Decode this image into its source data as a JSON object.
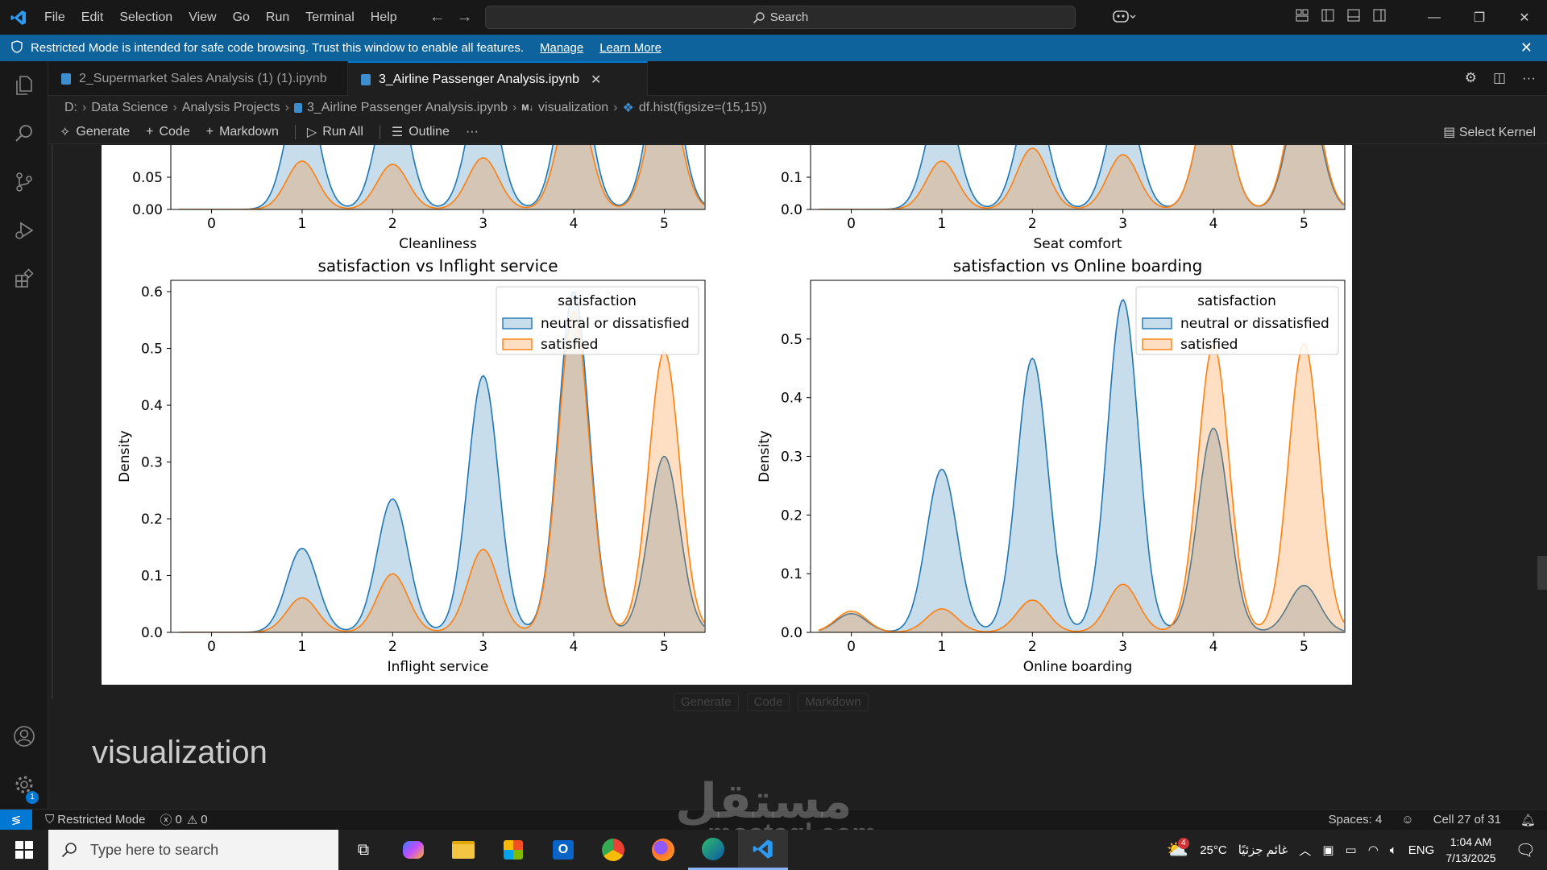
{
  "menu": [
    "File",
    "Edit",
    "Selection",
    "View",
    "Go",
    "Run",
    "Terminal",
    "Help"
  ],
  "search": {
    "label": "Search"
  },
  "banner": {
    "text": "Restricted Mode is intended for safe code browsing. Trust this window to enable all features.",
    "manage": "Manage",
    "learn_more": "Learn More"
  },
  "tabs": [
    {
      "label": "2_Supermarket Sales Analysis (1) (1).ipynb",
      "active": false
    },
    {
      "label": "3_Airline Passenger Analysis.ipynb",
      "active": true
    }
  ],
  "breadcrumb": [
    "D:",
    "Data Science",
    "Analysis Projects",
    "3_Airline Passenger Analysis.ipynb",
    "visualization",
    "df.hist(figsize=(15,15))"
  ],
  "toolbar": {
    "generate": "Generate",
    "code": "Code",
    "markdown": "Markdown",
    "run_all": "Run All",
    "outline": "Outline",
    "more": "···",
    "kernel": "Select Kernel"
  },
  "cell_add": {
    "generate": "Generate",
    "code": "Code",
    "markdown": "Markdown"
  },
  "markdown_heading": "visualization",
  "status": {
    "restricted": "Restricted Mode",
    "errors": "0",
    "warnings": "0",
    "spaces": "Spaces: 4",
    "cell": "Cell 27 of 31"
  },
  "activity_badge": "1",
  "taskbar": {
    "search_placeholder": "Type here to search",
    "weather_temp": "25°C",
    "weather_text": "غائم جزئيًا",
    "weather_badge": "4",
    "lang": "ENG",
    "time": "1:04 AM",
    "date": "7/13/2025"
  },
  "watermark": {
    "line1": "مستقل",
    "line2": "mostaql.com"
  },
  "chart_data": [
    {
      "type": "area",
      "title": "",
      "xlabel": "Cleanliness",
      "ylabel": "",
      "y_ticks": [
        "0.00",
        "0.05"
      ],
      "x_ticks": [
        "0",
        "1",
        "2",
        "3",
        "4",
        "5"
      ],
      "partial": true
    },
    {
      "type": "area",
      "title": "",
      "xlabel": "Seat comfort",
      "ylabel": "",
      "y_ticks": [
        "0.0",
        "0.1"
      ],
      "x_ticks": [
        "0",
        "1",
        "2",
        "3",
        "4",
        "5"
      ],
      "partial": true
    },
    {
      "type": "area",
      "title": "satisfaction vs Inflight service",
      "xlabel": "Inflight service",
      "ylabel": "Density",
      "ylim": [
        0,
        0.62
      ],
      "y_ticks": [
        "0.0",
        "0.1",
        "0.2",
        "0.3",
        "0.4",
        "0.5",
        "0.6"
      ],
      "x_ticks": [
        "0",
        "1",
        "2",
        "3",
        "4",
        "5"
      ],
      "legend_title": "satisfaction",
      "legend_position": "top-right",
      "series": [
        {
          "name": "neutral or dissatisfied",
          "color": "#1f77b4",
          "x": [
            0,
            1,
            2,
            3,
            4,
            5
          ],
          "values": [
            0.0,
            0.148,
            0.235,
            0.452,
            0.6,
            0.31
          ]
        },
        {
          "name": "satisfied",
          "color": "#ff7f0e",
          "x": [
            0,
            1,
            2,
            3,
            4,
            5
          ],
          "values": [
            0.0,
            0.061,
            0.103,
            0.146,
            0.565,
            0.495
          ]
        }
      ]
    },
    {
      "type": "area",
      "title": "satisfaction vs Online boarding",
      "xlabel": "Online boarding",
      "ylabel": "Density",
      "ylim": [
        0,
        0.6
      ],
      "y_ticks": [
        "0.0",
        "0.1",
        "0.2",
        "0.3",
        "0.4",
        "0.5"
      ],
      "x_ticks": [
        "0",
        "1",
        "2",
        "3",
        "4",
        "5"
      ],
      "legend_title": "satisfaction",
      "legend_position": "top-right",
      "series": [
        {
          "name": "neutral or dissatisfied",
          "color": "#1f77b4",
          "x": [
            0,
            1,
            2,
            3,
            4,
            5
          ],
          "values": [
            0.032,
            0.278,
            0.467,
            0.567,
            0.348,
            0.08
          ]
        },
        {
          "name": "satisfied",
          "color": "#ff7f0e",
          "x": [
            0,
            1,
            2,
            3,
            4,
            5
          ],
          "values": [
            0.036,
            0.04,
            0.055,
            0.082,
            0.49,
            0.493
          ]
        }
      ]
    }
  ]
}
